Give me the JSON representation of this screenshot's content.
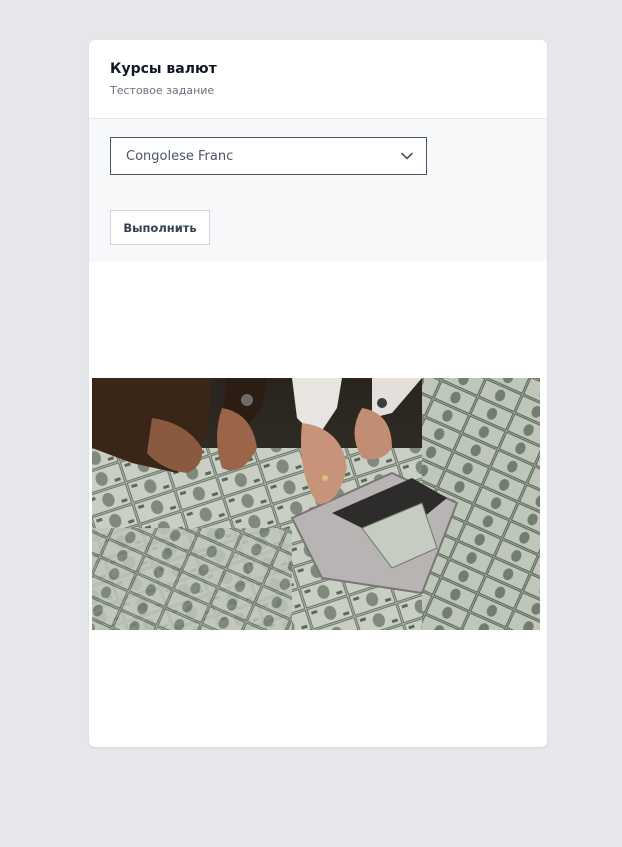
{
  "card": {
    "title": "Курсы валют",
    "subtitle": "Тестовое задание"
  },
  "form": {
    "currency_select": {
      "selected": "Congolese Franc"
    },
    "submit_label": "Выполнить"
  },
  "image": {
    "alt": "hands counting stacks of dollar bills with a money counting machine",
    "icon": "chevron-down-icon"
  }
}
